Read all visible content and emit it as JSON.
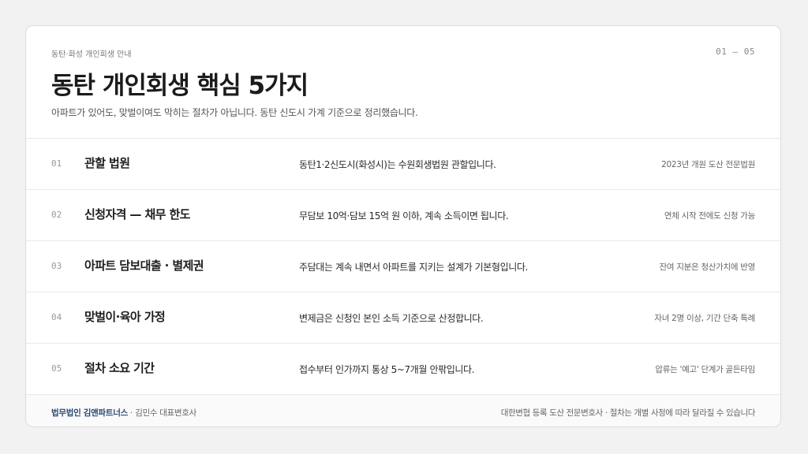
{
  "header": {
    "eyebrow": "동탄·화성 개인회생 안내",
    "page_indicator": "01 — 05",
    "title": "동탄 개인회생 핵심 5가지",
    "subtitle": "아파트가 있어도, 맞벌이여도 막히는 절차가 아닙니다. 동탄 신도시 가계 기준으로 정리했습니다."
  },
  "rows": [
    {
      "num": "01",
      "title": "관할 법원",
      "desc": "동탄1·2신도시(화성시)는 수원회생법원 관할입니다.",
      "note": "2023년 개원 도산 전문법원"
    },
    {
      "num": "02",
      "title": "신청자격 — 채무 한도",
      "desc": "무담보 10억·담보 15억 원 이하, 계속 소득이면 됩니다.",
      "note": "연체 시작 전에도 신청 가능"
    },
    {
      "num": "03",
      "title": "아파트 담보대출 · 별제권",
      "desc": "주담대는 계속 내면서 아파트를 지키는 설계가 기본형입니다.",
      "note": "잔여 지분은 청산가치에 반영"
    },
    {
      "num": "04",
      "title": "맞벌이·육아 가정",
      "desc": "변제금은 신청인 본인 소득 기준으로 산정합니다.",
      "note": "자녀 2명 이상, 기간 단축 특례"
    },
    {
      "num": "05",
      "title": "절차 소요 기간",
      "desc": "접수부터 인가까지 통상 5~7개월 안팎입니다.",
      "note": "압류는 '예고' 단계가 골든타임"
    }
  ],
  "footer": {
    "firm": "법무법인 김앤파트너스",
    "lawyer": " · 김민수 대표변호사",
    "disclaimer": "대한변협 등록 도산 전문변호사 · 절차는 개별 사정에 따라 달라질 수 있습니다"
  }
}
